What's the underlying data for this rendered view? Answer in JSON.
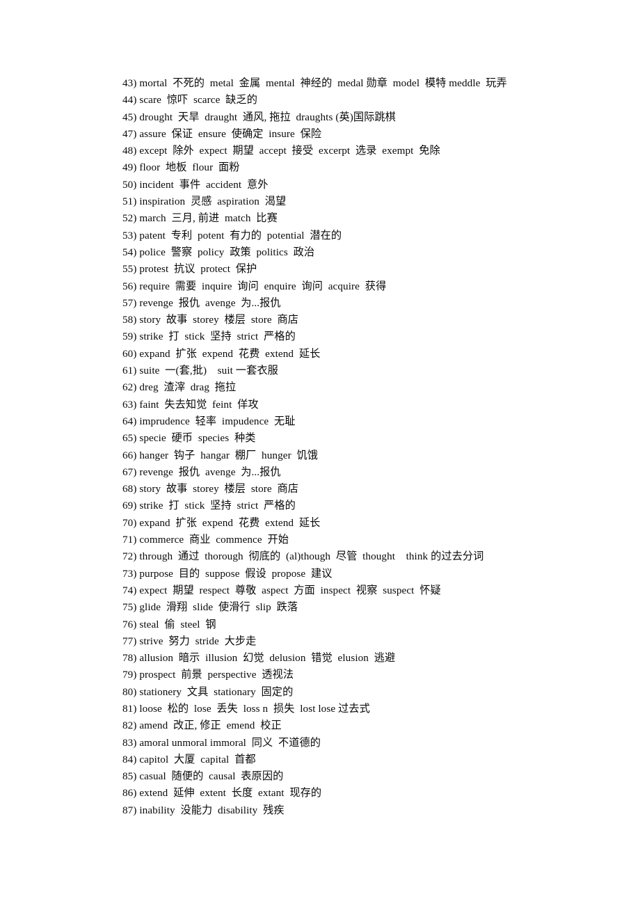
{
  "document": {
    "background_color": "#ffffff",
    "text_color": "#0a0a0a",
    "entries": [
      {
        "number": "43)",
        "text": "43) mortal  不死的  metal  金属  mental  神经的  medal 勋章  model  模特 meddle  玩弄"
      },
      {
        "number": "44)",
        "text": "44) scare  惊吓  scarce  缺乏的"
      },
      {
        "number": "45)",
        "text": "45) drought  天旱  draught  通风, 拖拉  draughts (英)国际跳棋"
      },
      {
        "number": "47)",
        "text": "47) assure  保证  ensure  使确定  insure  保险"
      },
      {
        "number": "48)",
        "text": "48) except  除外  expect  期望  accept  接受  excerpt  选录  exempt  免除"
      },
      {
        "number": "49)",
        "text": "49) floor  地板  flour  面粉"
      },
      {
        "number": "50)",
        "text": "50) incident  事件  accident  意外"
      },
      {
        "number": "51)",
        "text": "51) inspiration  灵感  aspiration  渴望"
      },
      {
        "number": "52)",
        "text": "52) march  三月, 前进  match  比赛"
      },
      {
        "number": "53)",
        "text": "53) patent  专利  potent  有力的  potential  潜在的"
      },
      {
        "number": "54)",
        "text": "54) police  警察  policy  政策  politics  政治"
      },
      {
        "number": "55)",
        "text": "55) protest  抗议  protect  保护"
      },
      {
        "number": "56)",
        "text": "56) require  需要  inquire  询问  enquire  询问  acquire  获得"
      },
      {
        "number": "57)",
        "text": "57) revenge  报仇  avenge  为...报仇"
      },
      {
        "number": "58)",
        "text": "58) story  故事  storey  楼层  store  商店"
      },
      {
        "number": "59)",
        "text": "59) strike  打  stick  坚持  strict  严格的"
      },
      {
        "number": "60)",
        "text": "60) expand  扩张  expend  花费  extend  延长"
      },
      {
        "number": "61)",
        "text": "61) suite  一(套,批)    suit 一套衣服"
      },
      {
        "number": "62)",
        "text": "62) dreg  渣滓  drag  拖拉"
      },
      {
        "number": "63)",
        "text": "63) faint  失去知觉  feint  佯攻"
      },
      {
        "number": "64)",
        "text": "64) imprudence  轻率  impudence  无耻"
      },
      {
        "number": "65)",
        "text": "65) specie  硬币  species  种类"
      },
      {
        "number": "66)",
        "text": "66) hanger  钩子  hangar  棚厂  hunger  饥饿"
      },
      {
        "number": "67)",
        "text": "67) revenge  报仇  avenge  为...报仇"
      },
      {
        "number": "68)",
        "text": "68) story  故事  storey  楼层  store  商店"
      },
      {
        "number": "69)",
        "text": "69) strike  打  stick  坚持  strict  严格的"
      },
      {
        "number": "70)",
        "text": "70) expand  扩张  expend  花费  extend  延长"
      },
      {
        "number": "71)",
        "text": "71) commerce  商业  commence  开始"
      },
      {
        "number": "72)",
        "text": "72) through  通过  thorough  彻底的  (al)though  尽管  thought    think 的过去分词"
      },
      {
        "number": "73)",
        "text": "73) purpose  目的  suppose  假设  propose  建议"
      },
      {
        "number": "74)",
        "text": "74) expect  期望  respect  尊敬  aspect  方面  inspect  视察  suspect  怀疑"
      },
      {
        "number": "75)",
        "text": "75) glide  滑翔  slide  使滑行  slip  跌落"
      },
      {
        "number": "76)",
        "text": "76) steal  偷  steel  钢"
      },
      {
        "number": "77)",
        "text": "77) strive  努力  stride  大步走"
      },
      {
        "number": "78)",
        "text": "78) allusion  暗示  illusion  幻觉  delusion  错觉  elusion  逃避"
      },
      {
        "number": "79)",
        "text": "79) prospect  前景  perspective  透视法"
      },
      {
        "number": "80)",
        "text": "80) stationery  文具  stationary  固定的"
      },
      {
        "number": "81)",
        "text": "81) loose  松的  lose  丢失  loss n  损失  lost lose 过去式"
      },
      {
        "number": "82)",
        "text": "82) amend  改正, 修正  emend  校正"
      },
      {
        "number": "83)",
        "text": "83) amoral unmoral immoral  同义  不道德的"
      },
      {
        "number": "84)",
        "text": "84) capitol  大厦  capital  首都"
      },
      {
        "number": "85)",
        "text": "85) casual  随便的  causal  表原因的"
      },
      {
        "number": "86)",
        "text": "86) extend  延伸  extent  长度  extant  现存的"
      },
      {
        "number": "87)",
        "text": "87) inability  没能力  disability  残疾"
      }
    ]
  }
}
